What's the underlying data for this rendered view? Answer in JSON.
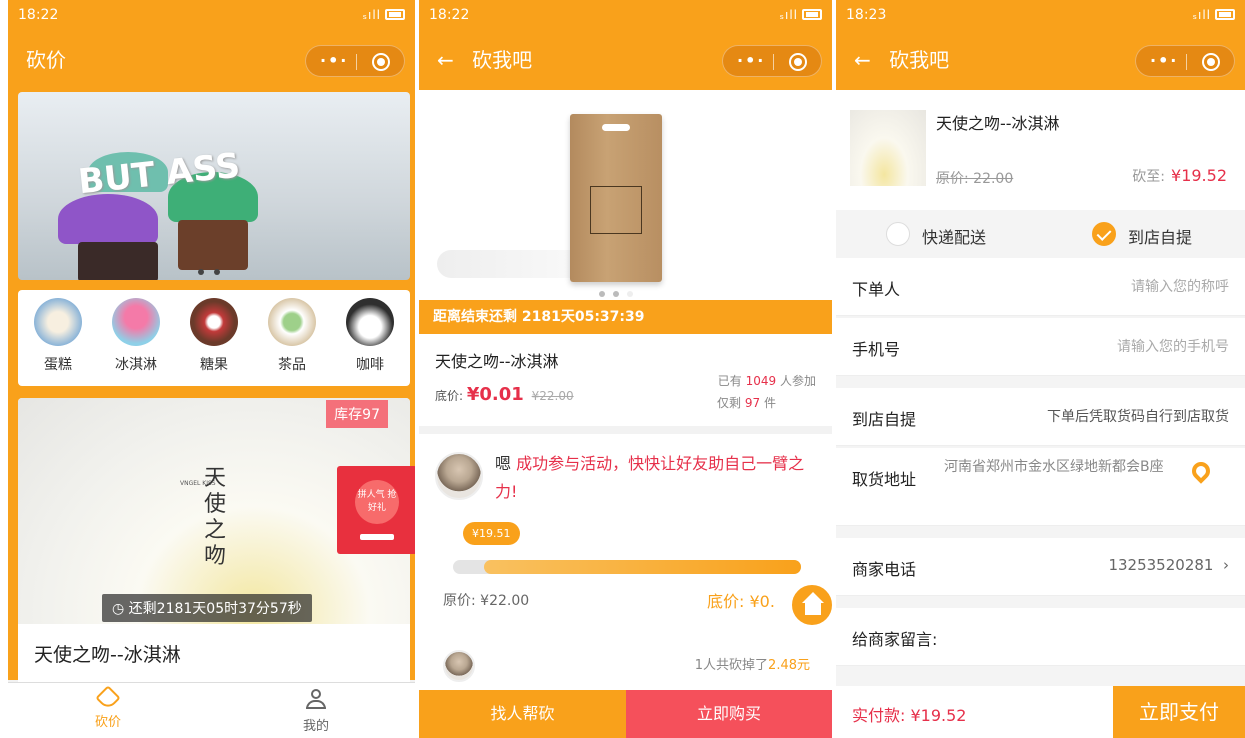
{
  "colors": {
    "accent": "#f9a11b",
    "price_red": "#e6304a",
    "stock_badge": "#f4707a",
    "buy_button": "#f5505b"
  },
  "p1": {
    "time": "18:22",
    "title": "砍价",
    "categories": [
      "蛋糕",
      "冰淇淋",
      "糖果",
      "茶品",
      "咖啡"
    ],
    "banner_text": "BUT ASS",
    "stock": "库存97",
    "brand_small": "VNGEL KISS",
    "brand_big": "天使之吻",
    "countdown": "还剩2181天05时37分57秒",
    "product_title": "天使之吻--冰淇淋",
    "gift_text": "拼人气 抢好礼",
    "tabs": [
      "砍价",
      "我的"
    ]
  },
  "p2": {
    "time": "18:22",
    "title": "砍我吧",
    "timer": "距离结束还剩 2181天05:37:39",
    "product_title": "天使之吻--冰淇淋",
    "floor_label": "底价:",
    "floor_price": "¥0.01",
    "orig_price": "¥22.00",
    "joined_pre": "已有",
    "joined_count": "1049",
    "joined_post": "人参加",
    "remain_pre": "仅剩",
    "remain_count": "97",
    "remain_post": "件",
    "msg_pre": "嗯",
    "msg_highlight": "成功参与活动，快快让好友助自己一臂之力!",
    "tip_price": "¥19.51",
    "progress": 0.91,
    "orig_line": "原价: ¥22.00",
    "floor_line": "底价: ¥0.",
    "total_pre": "1人共砍掉了",
    "total_amount": "2.48元",
    "btn_help": "找人帮砍",
    "btn_buy": "立即购买"
  },
  "p3": {
    "time": "18:23",
    "title": "砍我吧",
    "product_title": "天使之吻--冰淇淋",
    "orig_price": "原价: 22.00",
    "cut_label": "砍至:",
    "cut_price": "¥19.52",
    "delivery_express": "快递配送",
    "delivery_pickup": "到店自提",
    "orderer_label": "下单人",
    "orderer_placeholder": "请输入您的称呼",
    "phone_label": "手机号",
    "phone_placeholder": "请输入您的手机号",
    "pickup_label": "到店自提",
    "pickup_value": "下单后凭取货码自行到店取货",
    "address_label": "取货地址",
    "address_value": "河南省郑州市金水区绿地新都会B座",
    "merchant_phone_label": "商家电话",
    "merchant_phone_value": "13253520281",
    "message_label": "给商家留言:",
    "pay_label": "实付款: ¥19.52",
    "pay_button": "立即支付"
  }
}
